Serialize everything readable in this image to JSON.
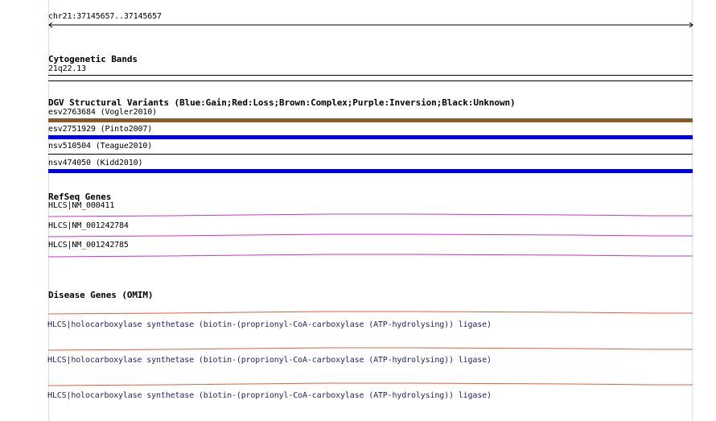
{
  "position": {
    "label": "chr21:37145657..37145657"
  },
  "cytoband": {
    "title": "Cytogenetic Bands",
    "band": "21q22.13"
  },
  "dgv": {
    "title": "DGV Structural Variants (Blue:Gain;Red:Loss;Brown:Complex;Purple:Inversion;Black:Unknown)",
    "items": [
      {
        "label": "esv2763684 (Vogler2010)",
        "type": "Complex",
        "color": "#8b5a2b"
      },
      {
        "label": "esv2751929 (Pinto2007)",
        "type": "Gain",
        "color": "#0000e6"
      },
      {
        "label": "nsv510504 (Teague2010)",
        "type": "Unknown",
        "color": "#000000"
      },
      {
        "label": "nsv474050 (Kidd2010)",
        "type": "Gain",
        "color": "#0000e6"
      }
    ]
  },
  "refseq": {
    "title": "RefSeq Genes",
    "color": "#cc33cc",
    "items": [
      {
        "label": "HLCS|NM_000411"
      },
      {
        "label": "HLCS|NM_001242784"
      },
      {
        "label": "HLCS|NM_001242785"
      }
    ]
  },
  "omim": {
    "title": "Disease Genes (OMIM)",
    "color": "#e06040",
    "text_color": "#1f1f6b",
    "items": [
      {
        "label": "HLCS|holocarboxylase synthetase (biotin-(proprionyl-CoA-carboxylase (ATP-hydrolysing)) ligase)"
      },
      {
        "label": "HLCS|holocarboxylase synthetase (biotin-(proprionyl-CoA-carboxylase (ATP-hydrolysing)) ligase)"
      },
      {
        "label": "HLCS|holocarboxylase synthetase (biotin-(proprionyl-CoA-carboxylase (ATP-hydrolysing)) ligase)"
      }
    ]
  }
}
